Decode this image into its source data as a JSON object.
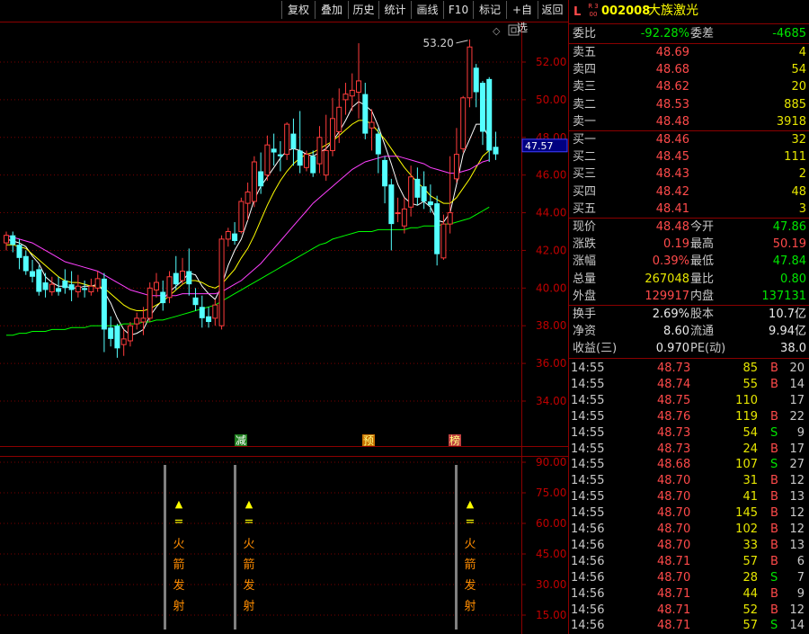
{
  "toolbar": {
    "buttons": [
      "复权",
      "叠加",
      "历史",
      "统计",
      "画线",
      "F10",
      "标记",
      "+自选",
      "返回"
    ]
  },
  "chart": {
    "high_label": "53.20",
    "current_price_tag": "47.57",
    "price_axis": [
      "52.00",
      "50.00",
      "48.00",
      "46.00",
      "44.00",
      "42.00",
      "40.00",
      "38.00",
      "36.00",
      "34.00"
    ],
    "indicator_axis": [
      "90.00",
      "75.00",
      "60.00",
      "45.00",
      "30.00",
      "15.00"
    ],
    "markers": [
      "减",
      "预",
      "榜"
    ],
    "signal_symbols": [
      "▲",
      "="
    ],
    "signal_text": [
      "火",
      "箭",
      "发",
      "射"
    ],
    "colors": {
      "up": "#ff3c3c",
      "down": "#54ffff",
      "ma5": "#ffffff",
      "ma10": "#ffff00",
      "ma20": "#ff40ff",
      "ma60": "#00ff00"
    }
  },
  "chart_data": {
    "type": "candlestick",
    "ylim": [
      33,
      54
    ],
    "candles": [
      {
        "o": 42.4,
        "c": 42.8,
        "h": 43.0,
        "l": 42.0
      },
      {
        "o": 42.8,
        "c": 42.3,
        "h": 43.0,
        "l": 41.9
      },
      {
        "o": 42.3,
        "c": 41.6,
        "h": 42.6,
        "l": 41.0
      },
      {
        "o": 41.7,
        "c": 40.9,
        "h": 42.0,
        "l": 40.7
      },
      {
        "o": 40.9,
        "c": 40.6,
        "h": 41.5,
        "l": 40.3
      },
      {
        "o": 41.0,
        "c": 39.8,
        "h": 41.2,
        "l": 39.6
      },
      {
        "o": 40.3,
        "c": 39.9,
        "h": 40.8,
        "l": 39.5
      },
      {
        "o": 39.8,
        "c": 40.2,
        "h": 40.6,
        "l": 39.6
      },
      {
        "o": 40.0,
        "c": 39.8,
        "h": 40.6,
        "l": 39.6
      },
      {
        "o": 40.4,
        "c": 40.0,
        "h": 41.0,
        "l": 39.7
      },
      {
        "o": 40.2,
        "c": 39.9,
        "h": 40.9,
        "l": 39.3
      },
      {
        "o": 39.8,
        "c": 40.1,
        "h": 40.7,
        "l": 39.5
      },
      {
        "o": 40.0,
        "c": 39.9,
        "h": 40.4,
        "l": 39.5
      },
      {
        "o": 39.8,
        "c": 40.1,
        "h": 40.5,
        "l": 39.6
      },
      {
        "o": 40.0,
        "c": 40.5,
        "h": 40.9,
        "l": 39.8
      },
      {
        "o": 40.5,
        "c": 37.8,
        "h": 40.8,
        "l": 36.6
      },
      {
        "o": 37.9,
        "c": 37.3,
        "h": 38.5,
        "l": 36.9
      },
      {
        "o": 38.0,
        "c": 36.8,
        "h": 38.1,
        "l": 36.3
      },
      {
        "o": 37.0,
        "c": 37.3,
        "h": 37.8,
        "l": 36.4
      },
      {
        "o": 37.2,
        "c": 38.0,
        "h": 38.2,
        "l": 36.9
      },
      {
        "o": 38.1,
        "c": 38.4,
        "h": 38.7,
        "l": 37.8
      },
      {
        "o": 38.2,
        "c": 38.4,
        "h": 39.0,
        "l": 37.5
      },
      {
        "o": 38.4,
        "c": 40.0,
        "h": 40.3,
        "l": 38.2
      },
      {
        "o": 39.9,
        "c": 40.3,
        "h": 40.8,
        "l": 39.5
      },
      {
        "o": 39.8,
        "c": 39.2,
        "h": 40.4,
        "l": 38.8
      },
      {
        "o": 39.5,
        "c": 40.6,
        "h": 40.9,
        "l": 39.2
      },
      {
        "o": 40.8,
        "c": 40.2,
        "h": 41.7,
        "l": 39.9
      },
      {
        "o": 40.4,
        "c": 40.9,
        "h": 41.6,
        "l": 40.2
      },
      {
        "o": 40.9,
        "c": 40.2,
        "h": 42.1,
        "l": 39.6
      },
      {
        "o": 39.5,
        "c": 39.1,
        "h": 40.0,
        "l": 38.8
      },
      {
        "o": 39.0,
        "c": 38.4,
        "h": 39.6,
        "l": 37.9
      },
      {
        "o": 38.5,
        "c": 38.2,
        "h": 39.0,
        "l": 37.9
      },
      {
        "o": 38.4,
        "c": 39.1,
        "h": 39.4,
        "l": 38.0
      },
      {
        "o": 38.0,
        "c": 42.6,
        "h": 42.8,
        "l": 37.8
      },
      {
        "o": 42.6,
        "c": 43.0,
        "h": 43.2,
        "l": 42.2
      },
      {
        "o": 42.9,
        "c": 42.5,
        "h": 43.5,
        "l": 42.3
      },
      {
        "o": 43.0,
        "c": 44.6,
        "h": 44.8,
        "l": 42.9
      },
      {
        "o": 44.5,
        "c": 45.1,
        "h": 45.6,
        "l": 43.6
      },
      {
        "o": 44.6,
        "c": 46.7,
        "h": 47.0,
        "l": 44.3
      },
      {
        "o": 46.2,
        "c": 45.4,
        "h": 47.2,
        "l": 45.0
      },
      {
        "o": 46.0,
        "c": 47.6,
        "h": 48.1,
        "l": 45.7
      },
      {
        "o": 47.4,
        "c": 47.2,
        "h": 48.2,
        "l": 46.5
      },
      {
        "o": 47.1,
        "c": 47.0,
        "h": 47.8,
        "l": 46.2
      },
      {
        "o": 47.1,
        "c": 48.7,
        "h": 48.8,
        "l": 46.8
      },
      {
        "o": 48.2,
        "c": 47.4,
        "h": 49.0,
        "l": 46.5
      },
      {
        "o": 47.3,
        "c": 46.5,
        "h": 49.4,
        "l": 46.1
      },
      {
        "o": 46.4,
        "c": 47.1,
        "h": 47.3,
        "l": 46.2
      },
      {
        "o": 47.0,
        "c": 46.1,
        "h": 47.3,
        "l": 45.9
      },
      {
        "o": 46.6,
        "c": 48.0,
        "h": 48.6,
        "l": 46.1
      },
      {
        "o": 46.0,
        "c": 47.3,
        "h": 49.2,
        "l": 45.7
      },
      {
        "o": 47.3,
        "c": 49.0,
        "h": 50.1,
        "l": 47.0
      },
      {
        "o": 48.3,
        "c": 49.6,
        "h": 50.6,
        "l": 47.7
      },
      {
        "o": 50.0,
        "c": 50.3,
        "h": 50.9,
        "l": 49.2
      },
      {
        "o": 50.2,
        "c": 50.5,
        "h": 51.4,
        "l": 49.4
      },
      {
        "o": 50.4,
        "c": 51.0,
        "h": 53.0,
        "l": 49.0
      },
      {
        "o": 50.3,
        "c": 48.2,
        "h": 50.9,
        "l": 47.9
      },
      {
        "o": 48.5,
        "c": 48.8,
        "h": 49.5,
        "l": 47.3
      },
      {
        "o": 48.2,
        "c": 47.1,
        "h": 48.5,
        "l": 46.1
      },
      {
        "o": 46.8,
        "c": 45.4,
        "h": 47.0,
        "l": 44.5
      },
      {
        "o": 45.5,
        "c": 43.4,
        "h": 45.8,
        "l": 42.0
      },
      {
        "o": 44.0,
        "c": 44.0,
        "h": 44.8,
        "l": 43.5
      },
      {
        "o": 43.3,
        "c": 44.2,
        "h": 44.8,
        "l": 42.9
      },
      {
        "o": 44.3,
        "c": 45.9,
        "h": 46.5,
        "l": 43.8
      },
      {
        "o": 45.8,
        "c": 44.8,
        "h": 46.4,
        "l": 44.4
      },
      {
        "o": 45.4,
        "c": 44.6,
        "h": 46.2,
        "l": 44.2
      },
      {
        "o": 44.6,
        "c": 44.4,
        "h": 45.5,
        "l": 44.0
      },
      {
        "o": 44.5,
        "c": 41.8,
        "h": 44.9,
        "l": 41.2
      },
      {
        "o": 41.6,
        "c": 43.4,
        "h": 43.9,
        "l": 41.5
      },
      {
        "o": 43.4,
        "c": 44.0,
        "h": 47.0,
        "l": 42.9
      },
      {
        "o": 45.8,
        "c": 47.1,
        "h": 48.5,
        "l": 45.6
      },
      {
        "o": 47.4,
        "c": 50.1,
        "h": 50.2,
        "l": 47.2
      },
      {
        "o": 50.1,
        "c": 52.8,
        "h": 53.2,
        "l": 49.6
      },
      {
        "o": 51.7,
        "c": 50.4,
        "h": 51.9,
        "l": 49.6
      },
      {
        "o": 50.9,
        "c": 48.3,
        "h": 51.0,
        "l": 47.6
      },
      {
        "o": 51.1,
        "c": 47.3,
        "h": 51.2,
        "l": 46.7
      },
      {
        "o": 47.5,
        "c": 47.1,
        "h": 48.3,
        "l": 46.8
      }
    ],
    "ma_lines": [
      {
        "name": "ma5",
        "values": [
          42.6,
          42.5,
          42.4,
          42.2,
          41.7,
          41.3,
          40.6,
          40.3,
          40.1,
          40.1,
          40.0,
          40.0,
          40.1,
          40.1,
          40.2,
          39.8,
          39.2,
          38.4,
          37.8,
          37.5,
          37.6,
          37.8,
          38.5,
          39.0,
          39.4,
          39.8,
          40.1,
          40.4,
          40.8,
          40.7,
          40.1,
          39.7,
          39.4,
          40.1,
          41.2,
          42.0,
          42.6,
          43.6,
          44.7,
          45.4,
          45.9,
          46.4,
          46.9,
          47.3,
          47.4,
          47.3,
          47.1,
          47.0,
          47.2,
          47.4,
          47.8,
          48.3,
          48.9,
          49.6,
          49.9,
          49.7,
          49.4,
          48.6,
          47.6,
          46.6,
          45.5,
          44.8,
          44.5,
          44.4,
          44.6,
          44.3,
          43.6,
          43.5,
          44.0,
          45.5,
          47.1,
          47.9,
          48.7,
          48.7,
          47.9
        ]
      },
      {
        "name": "ma10",
        "values": [
          42.3,
          42.3,
          42.2,
          42.1,
          41.8,
          41.5,
          41.2,
          40.9,
          40.6,
          40.4,
          40.3,
          40.3,
          40.2,
          40.1,
          40.1,
          40.0,
          39.7,
          39.4,
          39.1,
          38.9,
          38.8,
          38.8,
          38.9,
          39.1,
          39.3,
          39.6,
          39.9,
          40.2,
          40.4,
          40.4,
          40.3,
          40.1,
          40.0,
          40.2,
          40.6,
          41.0,
          41.6,
          42.1,
          42.8,
          43.6,
          44.4,
          45.1,
          45.7,
          46.2,
          46.6,
          46.9,
          47.1,
          47.2,
          47.4,
          47.6,
          47.8,
          48.1,
          48.4,
          48.7,
          48.9,
          48.9,
          48.7,
          48.3,
          47.9,
          47.4,
          46.9,
          46.4,
          46.0,
          45.6,
          45.3,
          44.9,
          44.7,
          44.5,
          44.5,
          44.8,
          45.3,
          45.8,
          46.4,
          47.0,
          47.3
        ]
      },
      {
        "name": "ma20",
        "values": [
          42.8,
          42.7,
          42.6,
          42.5,
          42.4,
          42.2,
          42.0,
          41.8,
          41.6,
          41.4,
          41.3,
          41.2,
          41.1,
          41.0,
          40.9,
          40.7,
          40.5,
          40.3,
          40.1,
          39.9,
          39.8,
          39.7,
          39.6,
          39.6,
          39.6,
          39.6,
          39.6,
          39.7,
          39.7,
          39.7,
          39.7,
          39.7,
          39.7,
          39.8,
          40.0,
          40.2,
          40.4,
          40.7,
          41.0,
          41.3,
          41.7,
          42.1,
          42.5,
          42.9,
          43.3,
          43.7,
          44.1,
          44.5,
          44.8,
          45.1,
          45.4,
          45.7,
          46.0,
          46.3,
          46.5,
          46.7,
          46.8,
          46.9,
          47.0,
          47.0,
          47.0,
          46.9,
          46.8,
          46.7,
          46.6,
          46.4,
          46.3,
          46.2,
          46.1,
          46.1,
          46.2,
          46.3,
          46.5,
          46.7,
          46.8
        ]
      },
      {
        "name": "ma60",
        "values": [
          37.5,
          37.5,
          37.6,
          37.6,
          37.7,
          37.7,
          37.7,
          37.8,
          37.8,
          37.8,
          37.9,
          37.9,
          37.9,
          38.0,
          38.0,
          38.0,
          38.0,
          38.0,
          38.1,
          38.1,
          38.1,
          38.2,
          38.2,
          38.3,
          38.3,
          38.4,
          38.5,
          38.6,
          38.7,
          38.8,
          38.9,
          39.0,
          39.1,
          39.3,
          39.5,
          39.7,
          39.9,
          40.1,
          40.3,
          40.5,
          40.7,
          40.9,
          41.1,
          41.3,
          41.5,
          41.7,
          41.9,
          42.1,
          42.3,
          42.4,
          42.6,
          42.7,
          42.8,
          42.9,
          43.0,
          43.0,
          43.0,
          43.1,
          43.1,
          43.1,
          43.1,
          43.1,
          43.2,
          43.2,
          43.3,
          43.3,
          43.3,
          43.4,
          43.4,
          43.5,
          43.6,
          43.7,
          43.9,
          44.1,
          44.3
        ]
      }
    ]
  },
  "panel": {
    "market_code": "L",
    "market_badge": "R 300",
    "stock_code": "002008",
    "stock_name": "大族激光",
    "weibi": {
      "label": "委比",
      "value": "-92.28%",
      "label2": "委差",
      "value2": "-4685"
    },
    "asks": [
      {
        "label": "卖五",
        "price": "48.69",
        "vol": "4"
      },
      {
        "label": "卖四",
        "price": "48.68",
        "vol": "54"
      },
      {
        "label": "卖三",
        "price": "48.62",
        "vol": "20"
      },
      {
        "label": "卖二",
        "price": "48.53",
        "vol": "885"
      },
      {
        "label": "卖一",
        "price": "48.48",
        "vol": "3918"
      }
    ],
    "bids": [
      {
        "label": "买一",
        "price": "48.46",
        "vol": "32"
      },
      {
        "label": "买二",
        "price": "48.45",
        "vol": "111"
      },
      {
        "label": "买三",
        "price": "48.43",
        "vol": "2"
      },
      {
        "label": "买四",
        "price": "48.42",
        "vol": "48"
      },
      {
        "label": "买五",
        "price": "48.41",
        "vol": "3"
      }
    ],
    "quote": [
      {
        "l1": "现价",
        "v1": "48.48",
        "c1": "red",
        "l2": "今开",
        "v2": "47.86",
        "c2": "green"
      },
      {
        "l1": "涨跌",
        "v1": "0.19",
        "c1": "red",
        "l2": "最高",
        "v2": "50.19",
        "c2": "red"
      },
      {
        "l1": "涨幅",
        "v1": "0.39%",
        "c1": "red",
        "l2": "最低",
        "v2": "47.84",
        "c2": "green"
      },
      {
        "l1": "总量",
        "v1": "267048",
        "c1": "yellow",
        "l2": "量比",
        "v2": "0.80",
        "c2": "green"
      },
      {
        "l1": "外盘",
        "v1": "129917",
        "c1": "red",
        "l2": "内盘",
        "v2": "137131",
        "c2": "green"
      }
    ],
    "fundamentals": [
      {
        "l1": "换手",
        "v1": "2.69%",
        "l2": "股本",
        "v2": "10.7亿"
      },
      {
        "l1": "净资",
        "v1": "8.60",
        "l2": "流通",
        "v2": "9.94亿"
      },
      {
        "l1": "收益(三)",
        "v1": "0.970",
        "l2": "PE(动)",
        "v2": "38.0"
      }
    ],
    "ticks": [
      {
        "time": "14:55",
        "price": "48.73",
        "vol": "85",
        "bs": "B",
        "cnt": "20"
      },
      {
        "time": "14:55",
        "price": "48.74",
        "vol": "55",
        "bs": "B",
        "cnt": "14"
      },
      {
        "time": "14:55",
        "price": "48.75",
        "vol": "110",
        "bs": "",
        "cnt": "17"
      },
      {
        "time": "14:55",
        "price": "48.76",
        "vol": "119",
        "bs": "B",
        "cnt": "22"
      },
      {
        "time": "14:55",
        "price": "48.73",
        "vol": "54",
        "bs": "S",
        "cnt": "9"
      },
      {
        "time": "14:55",
        "price": "48.73",
        "vol": "24",
        "bs": "B",
        "cnt": "17"
      },
      {
        "time": "14:55",
        "price": "48.68",
        "vol": "107",
        "bs": "S",
        "cnt": "27"
      },
      {
        "time": "14:55",
        "price": "48.70",
        "vol": "31",
        "bs": "B",
        "cnt": "12"
      },
      {
        "time": "14:55",
        "price": "48.70",
        "vol": "41",
        "bs": "B",
        "cnt": "13"
      },
      {
        "time": "14:55",
        "price": "48.70",
        "vol": "145",
        "bs": "B",
        "cnt": "12"
      },
      {
        "time": "14:56",
        "price": "48.70",
        "vol": "102",
        "bs": "B",
        "cnt": "12"
      },
      {
        "time": "14:56",
        "price": "48.70",
        "vol": "33",
        "bs": "B",
        "cnt": "13"
      },
      {
        "time": "14:56",
        "price": "48.71",
        "vol": "57",
        "bs": "B",
        "cnt": "6"
      },
      {
        "time": "14:56",
        "price": "48.70",
        "vol": "28",
        "bs": "S",
        "cnt": "7"
      },
      {
        "time": "14:56",
        "price": "48.71",
        "vol": "44",
        "bs": "B",
        "cnt": "9"
      },
      {
        "time": "14:56",
        "price": "48.71",
        "vol": "52",
        "bs": "B",
        "cnt": "12"
      },
      {
        "time": "14:56",
        "price": "48.71",
        "vol": "57",
        "bs": "S",
        "cnt": "14"
      }
    ]
  }
}
